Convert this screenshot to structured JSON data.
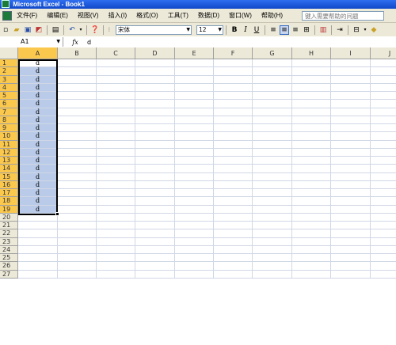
{
  "title": "Microsoft Excel - Book1",
  "menu": [
    "文件(F)",
    "编辑(E)",
    "视图(V)",
    "插入(I)",
    "格式(O)",
    "工具(T)",
    "数据(D)",
    "窗口(W)",
    "帮助(H)"
  ],
  "help_placeholder": "键入需要帮助的问题",
  "toolbar": {
    "font_name": "宋体",
    "font_size": "12",
    "bold": "B",
    "italic": "I",
    "underline": "U"
  },
  "formula_bar": {
    "name_box": "A1",
    "fx_label": "fx",
    "value": "d"
  },
  "sheet": {
    "columns": [
      "A",
      "B",
      "C",
      "D",
      "E",
      "F",
      "G",
      "H",
      "I",
      "J"
    ],
    "rows": [
      "1",
      "2",
      "3",
      "4",
      "5",
      "6",
      "7",
      "8",
      "9",
      "10",
      "11",
      "12",
      "13",
      "14",
      "15",
      "16",
      "17",
      "18",
      "19",
      "20",
      "21",
      "22",
      "23",
      "24",
      "25",
      "26",
      "27"
    ],
    "column_a_values": [
      "d",
      "d",
      "d",
      "d",
      "d",
      "d",
      "d",
      "d",
      "d",
      "d",
      "d",
      "d",
      "d",
      "d",
      "d",
      "d",
      "d",
      "d",
      "d"
    ]
  },
  "colors": {
    "selection_fill": "#b9cbe8",
    "header_selected": "#fbc84e",
    "chrome": "#ece9d8",
    "titlebar": "#1048c8"
  }
}
